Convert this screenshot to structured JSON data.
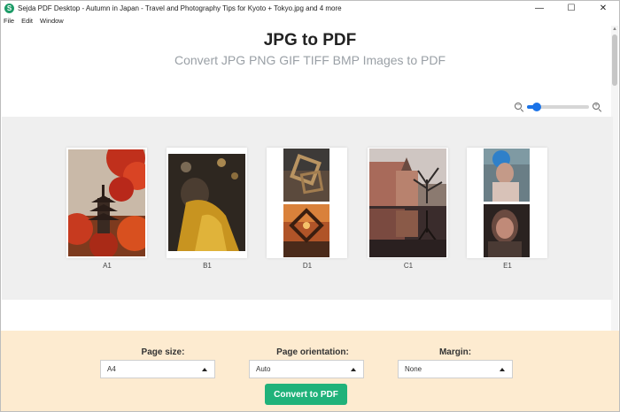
{
  "window": {
    "title": "Sejda PDF Desktop - Autumn in Japan - Travel and Photography Tips for Kyoto + Tokyo.jpg and 4 more",
    "logo_letter": "S",
    "controls": {
      "minimize": "—",
      "maximize": "☐",
      "close": "✕"
    }
  },
  "menu": {
    "items": [
      "File",
      "Edit",
      "Window"
    ]
  },
  "header": {
    "title": "JPG to PDF",
    "subtitle": "Convert JPG PNG GIF TIFF BMP Images to PDF"
  },
  "zoom": {
    "level": 0.15,
    "accent": "#1a73e8"
  },
  "pages": [
    {
      "label": "A1"
    },
    {
      "label": "B1"
    },
    {
      "label": "D1"
    },
    {
      "label": "C1"
    },
    {
      "label": "E1"
    }
  ],
  "options": {
    "page_size": {
      "label": "Page size:",
      "value": "A4"
    },
    "orientation": {
      "label": "Page orientation:",
      "value": "Auto"
    },
    "margin": {
      "label": "Margin:",
      "value": "None"
    }
  },
  "convert_button": {
    "label": "Convert to PDF",
    "color": "#20b27a"
  },
  "colors": {
    "bottom_panel": "#fdebd0",
    "pages_area": "#efefef",
    "brand": "#1d9b67"
  }
}
